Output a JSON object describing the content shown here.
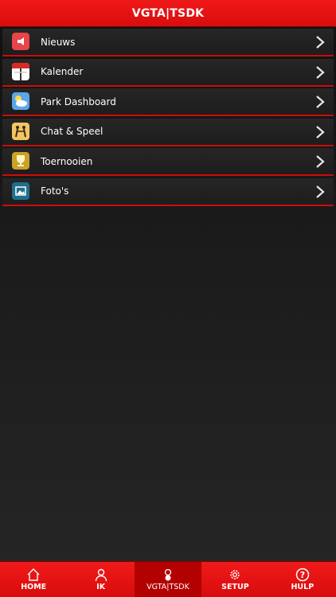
{
  "header": {
    "title": "VGTA|TSDK"
  },
  "menu": {
    "items": [
      {
        "label": "Nieuws",
        "icon": "megaphone-icon"
      },
      {
        "label": "Kalender",
        "icon": "calendar-icon"
      },
      {
        "label": "Park Dashboard",
        "icon": "weather-icon"
      },
      {
        "label": "Chat & Speel",
        "icon": "chat-play-icon"
      },
      {
        "label": "Toernooien",
        "icon": "trophy-icon"
      },
      {
        "label": "Foto's",
        "icon": "photo-icon"
      }
    ]
  },
  "tabbar": {
    "tabs": [
      {
        "label": "HOME",
        "icon": "home-icon"
      },
      {
        "label": "IK",
        "icon": "person-icon"
      },
      {
        "label": "VGTA|TSDK",
        "icon": "club-icon",
        "active": true
      },
      {
        "label": "SETUP",
        "icon": "gear-icon"
      },
      {
        "label": "HULP",
        "icon": "help-icon"
      }
    ]
  },
  "colors": {
    "accent": "#e31010",
    "background": "#1a1a1a"
  }
}
